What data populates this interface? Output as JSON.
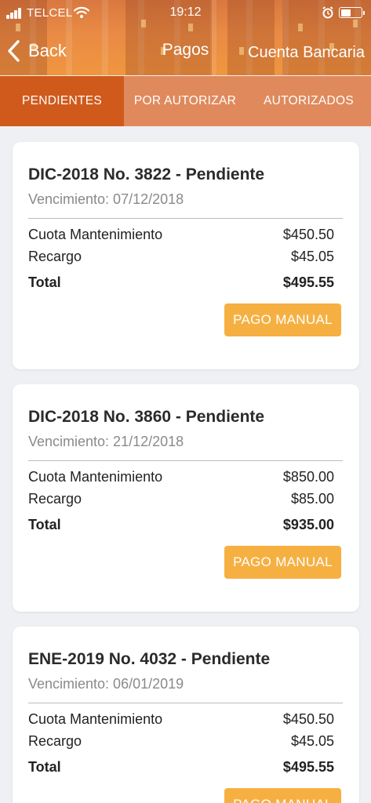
{
  "status_bar": {
    "carrier": "TELCEL",
    "time": "19:12"
  },
  "nav": {
    "back_label": "Back",
    "title": "Pagos",
    "right_label": "Cuenta Bancaria"
  },
  "tabs": [
    {
      "label": "PENDIENTES",
      "active": true
    },
    {
      "label": "POR AUTORIZAR",
      "active": false
    },
    {
      "label": "AUTORIZADOS",
      "active": false
    }
  ],
  "payments": [
    {
      "title": "DIC-2018 No. 3822 - Pendiente",
      "due": "Vencimiento: 07/12/2018",
      "fee_label": "Cuota Mantenimiento",
      "fee_value": "$450.50",
      "surcharge_label": "Recargo",
      "surcharge_value": "$45.05",
      "total_label": "Total",
      "total_value": "$495.55",
      "button_label": "PAGO MANUAL"
    },
    {
      "title": "DIC-2018 No. 3860 - Pendiente",
      "due": "Vencimiento: 21/12/2018",
      "fee_label": "Cuota Mantenimiento",
      "fee_value": "$850.00",
      "surcharge_label": "Recargo",
      "surcharge_value": "$85.00",
      "total_label": "Total",
      "total_value": "$935.00",
      "button_label": "PAGO MANUAL"
    },
    {
      "title": "ENE-2019 No. 4032 - Pendiente",
      "due": "Vencimiento: 06/01/2019",
      "fee_label": "Cuota Mantenimiento",
      "fee_value": "$450.50",
      "surcharge_label": "Recargo",
      "surcharge_value": "$45.05",
      "total_label": "Total",
      "total_value": "$495.55",
      "button_label": "PAGO MANUAL"
    }
  ],
  "colors": {
    "header_orange": "#e98b45",
    "active_tab": "#d05a1c",
    "tab_bar": "#e0895c",
    "button": "#f6b042",
    "background": "#eef0f3"
  },
  "icons": [
    "signal-icon",
    "wifi-icon",
    "alarm-icon",
    "battery-icon",
    "chevron-left-icon"
  ]
}
